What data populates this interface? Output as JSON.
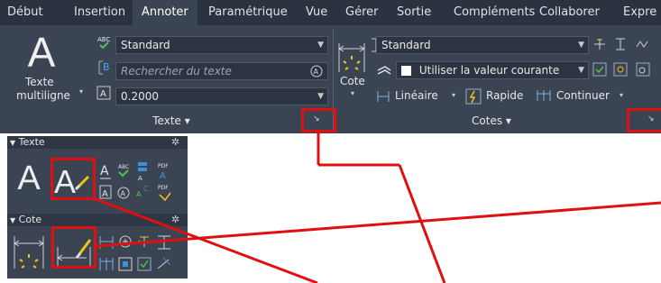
{
  "tabs": [
    "Début",
    "Insertion",
    "Annoter",
    "Paramétrique",
    "Vue",
    "Gérer",
    "Sortie",
    "Compléments",
    "Collaborer",
    "Expre"
  ],
  "active_tab": "Annoter",
  "text_panel": {
    "big_button_glyph": "A",
    "big_button_label_line1": "Texte",
    "big_button_label_line2": "multiligne",
    "style_value": "Standard",
    "search_placeholder": "Rechercher du texte",
    "height_value": "0.2000",
    "panel_title": "Texte ▾",
    "abc_icon": "spellcheck-icon",
    "find_icon": "find-text-icon",
    "height_icon": "text-height-icon"
  },
  "dim_panel": {
    "big_button_label": "Cote",
    "style_value": "Standard",
    "layer_value": "Utiliser la valeur courante",
    "linear_label": "Linéaire",
    "rapid_label": "Rapide",
    "continue_label": "Continuer",
    "panel_title": "Cotes ▾"
  },
  "palette": {
    "text_header": "Texte",
    "dim_header": "Cote"
  },
  "colors": {
    "ribbon_bg": "#3b4453",
    "tabbar_bg": "#2b3240",
    "highlight_red": "#e01010",
    "accent_yellow": "#f2c318",
    "accent_blue": "#3d8ee0",
    "accent_green": "#4fc24f"
  }
}
